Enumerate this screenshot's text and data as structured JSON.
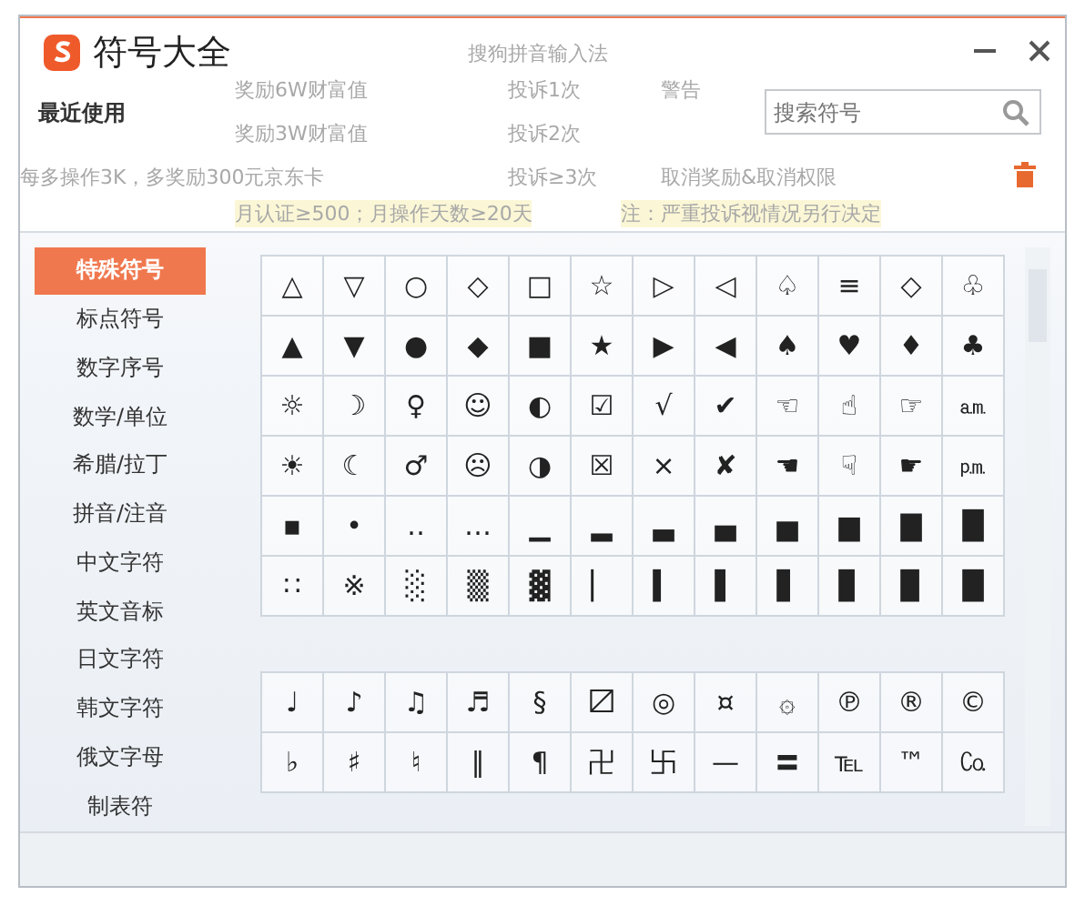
{
  "window": {
    "title": "符号大全"
  },
  "background_sheet": [
    "奖励6W财富值",
    "奖励3W财富值",
    "每多操作3K，多奖励300元京东卡",
    "月认证≥500；月操作天数≥20天",
    "搜狗拼音输入法",
    "投诉1次",
    "警告",
    "投诉2次",
    "投诉≥3次",
    "取消奖励&取消权限",
    "注：严重投诉视情况另行决定"
  ],
  "recent": {
    "label": "最近使用"
  },
  "search": {
    "placeholder": "搜索符号"
  },
  "sidebar": {
    "items": [
      {
        "label": "特殊符号",
        "selected": true
      },
      {
        "label": "标点符号",
        "selected": false
      },
      {
        "label": "数字序号",
        "selected": false
      },
      {
        "label": "数学/单位",
        "selected": false
      },
      {
        "label": "希腊/拉丁",
        "selected": false
      },
      {
        "label": "拼音/注音",
        "selected": false
      },
      {
        "label": "中文字符",
        "selected": false
      },
      {
        "label": "英文音标",
        "selected": false
      },
      {
        "label": "日文字符",
        "selected": false
      },
      {
        "label": "韩文字符",
        "selected": false
      },
      {
        "label": "俄文字母",
        "selected": false
      },
      {
        "label": "制表符",
        "selected": false
      }
    ]
  },
  "sections": [
    {
      "rows": [
        [
          "△",
          "▽",
          "○",
          "◇",
          "□",
          "☆",
          "▷",
          "◁",
          "♤",
          "≡",
          "◇",
          "♧"
        ],
        [
          "▲",
          "▼",
          "●",
          "◆",
          "■",
          "★",
          "▶",
          "◀",
          "♠",
          "♥",
          "♦",
          "♣"
        ],
        [
          "☼",
          "☽",
          "♀",
          "☺",
          "◐",
          "☑",
          "√",
          "✔",
          "☜",
          "☝",
          "☞",
          "㏂"
        ],
        [
          "☀",
          "☾",
          "♂",
          "☹",
          "◑",
          "☒",
          "×",
          "✘",
          "☚",
          "☟",
          "☛",
          "㏘"
        ],
        [
          "▪",
          "•",
          "‥",
          "…",
          "▁",
          "▂",
          "▃",
          "▄",
          "▅",
          "▆",
          "▇",
          "█"
        ],
        [
          "∷",
          "※",
          "░",
          "▒",
          "▓",
          "▏",
          "▍",
          "▌",
          "▋",
          "▊",
          "▉",
          "█"
        ]
      ]
    },
    {
      "rows": [
        [
          "♩",
          "♪",
          "♫",
          "♬",
          "§",
          "〼",
          "◎",
          "¤",
          "۞",
          "℗",
          "®",
          "©"
        ],
        [
          "♭",
          "♯",
          "♮",
          "‖",
          "¶",
          "卍",
          "卐",
          "—",
          "〓",
          "℡",
          "™",
          "㏇"
        ]
      ]
    }
  ]
}
